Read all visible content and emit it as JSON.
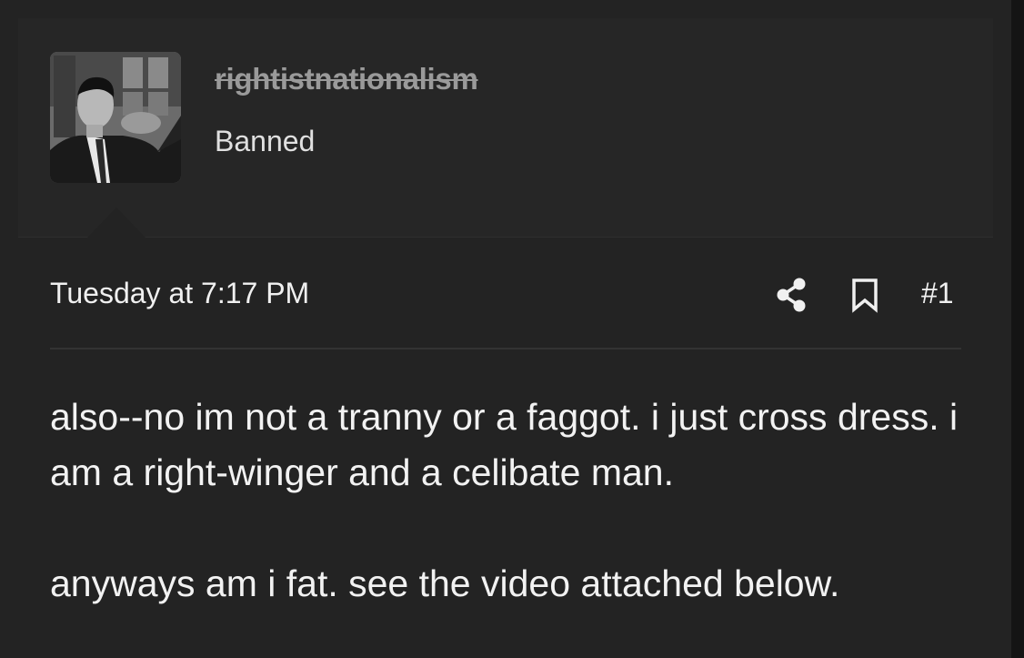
{
  "post": {
    "user": {
      "username": "rightistnationalism",
      "title": "Banned",
      "avatar_icon": "user-photo"
    },
    "meta": {
      "timestamp": "Tuesday at 7:17 PM",
      "share_icon": "share-icon",
      "bookmark_icon": "bookmark-icon",
      "post_number": "#1"
    },
    "body": {
      "paragraph_1": "also--no im not a tranny or a faggot. i just cross dress. i am a right-winger and a celibate man.",
      "paragraph_2": "anyways am i fat. see the video attached below."
    }
  },
  "colors": {
    "background": "#232323",
    "header_background": "#262626",
    "text": "#f2f2f2",
    "username_struck": "#9a9a9a"
  }
}
